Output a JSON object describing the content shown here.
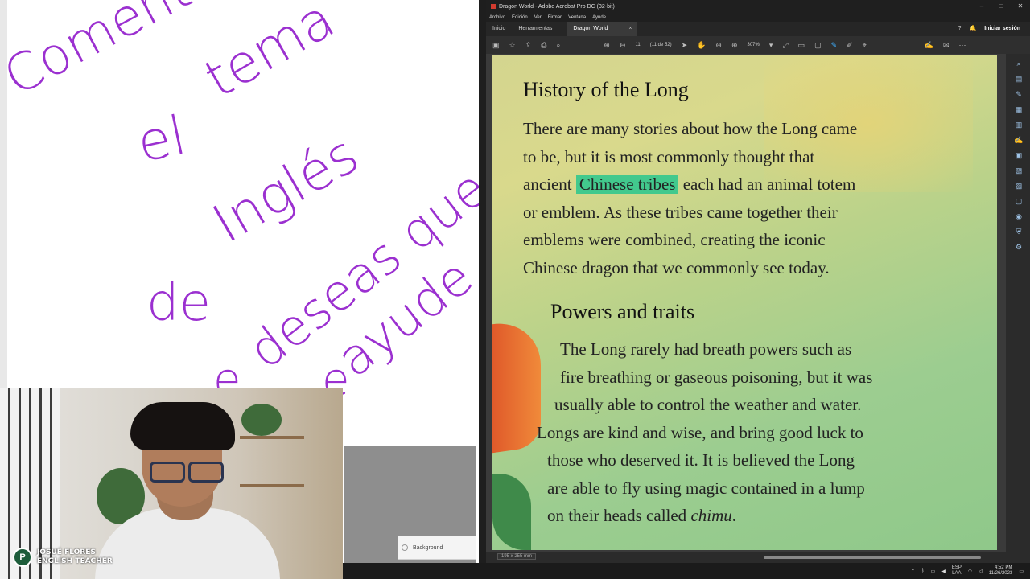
{
  "whiteboard": {
    "handwriting": [
      "Comenta",
      "el",
      "tema",
      "Inglés",
      "de",
      "deseas que",
      "ayude",
      "e",
      "e"
    ],
    "background_panel_label": "Background"
  },
  "webcam": {
    "badge_logo": "P",
    "badge_line1": "JOSUÉ FLORES",
    "badge_line2": "ENGLISH TEACHER"
  },
  "acrobat": {
    "title": "Dragon World - Adobe Acrobat Pro DC (32-bit)",
    "window_controls": [
      "–",
      "□",
      "✕"
    ],
    "menu": [
      "Archivo",
      "Edición",
      "Ver",
      "Firmar",
      "Ventana",
      "Ayude"
    ],
    "tabs": [
      "Inicio",
      "Herramientas"
    ],
    "active_tab": "Dragon World",
    "active_tab_close": "×",
    "sign_in": "Iniciar sesión",
    "page_current": "11",
    "page_total": "(11 de 52)",
    "zoom": "307%",
    "page_size": "195 x 255 mm"
  },
  "document": {
    "heading1": "History of the Long",
    "para1_lines": [
      "There are many stories about how the Long came",
      "to be, but it is most commonly thought that"
    ],
    "para1_line3_pre": "ancient",
    "para1_highlight": "Chinese tribes",
    "para1_line3_post": "each had an animal totem",
    "para1_lines_after": [
      "or emblem. As these tribes came together their",
      "emblems were combined, creating the iconic",
      "Chinese dragon that we commonly see today."
    ],
    "heading2": "Powers and traits",
    "para2_lines": [
      "The Long rarely had breath powers such as",
      "fire breathing or gaseous poisoning, but it was",
      "usually able to control the weather and water.",
      "Longs are kind and wise, and bring good luck to",
      "those who deserved it. It is believed the Long",
      "are able to fly using magic contained in a lump"
    ],
    "para2_last_pre": "on their heads called",
    "para2_last_italic": "chimu",
    "para2_last_post": "."
  },
  "taskbar": {
    "lang_top": "ESP",
    "lang_bottom": "LAA",
    "time": "4:52 PM",
    "date": "11/26/2023"
  },
  "colors": {
    "highlight": "#42c98d",
    "handwriting": "#9b30d0",
    "acrobat_dark": "#2b2b2b"
  }
}
